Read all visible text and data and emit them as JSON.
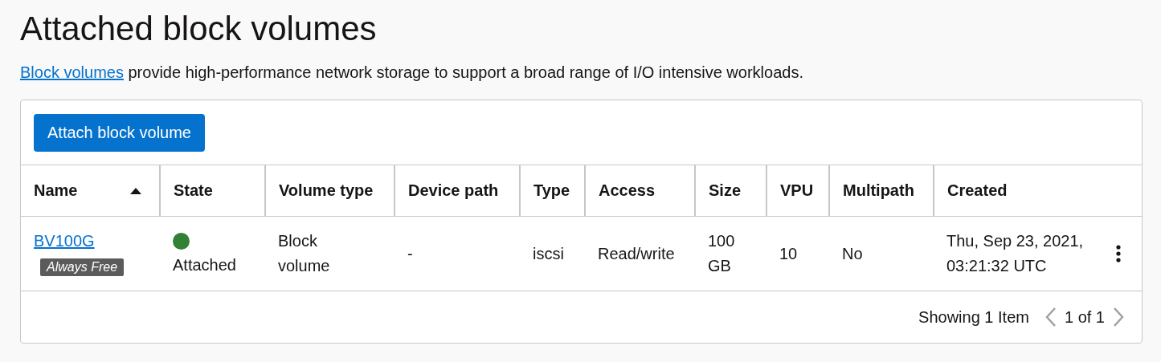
{
  "page": {
    "title": "Attached block volumes",
    "description_link": "Block volumes",
    "description": " provide high-performance network storage to support a broad range of I/O intensive workloads."
  },
  "toolbar": {
    "buttons": [
      "Attach block volume"
    ]
  },
  "table": {
    "columns": [
      {
        "label": "Name",
        "sorted": true
      },
      {
        "label": "State",
        "sorted": false
      },
      {
        "label": "Volume type",
        "sorted": false
      },
      {
        "label": "Device path",
        "sorted": false
      },
      {
        "label": "Type",
        "sorted": false
      },
      {
        "label": "Access",
        "sorted": false
      },
      {
        "label": "Size",
        "sorted": false
      },
      {
        "label": "VPU",
        "sorted": false
      },
      {
        "label": "Multipath",
        "sorted": false
      },
      {
        "label": "Created",
        "sorted": false
      }
    ],
    "rows": [
      {
        "name": "BV100G",
        "badge": "Always Free",
        "state": "Attached",
        "color": "#318035",
        "volume_type": "Block volume",
        "device_path": "-",
        "type": "iscsi",
        "access": "Read/write",
        "size": "100 GB",
        "vpu": "10",
        "multipath": "No",
        "created": "Thu, Sep 23, 2021, 03:21:32 UTC"
      }
    ]
  },
  "footer": {
    "summary": "Showing 1 Item",
    "page": "1 of 1"
  }
}
